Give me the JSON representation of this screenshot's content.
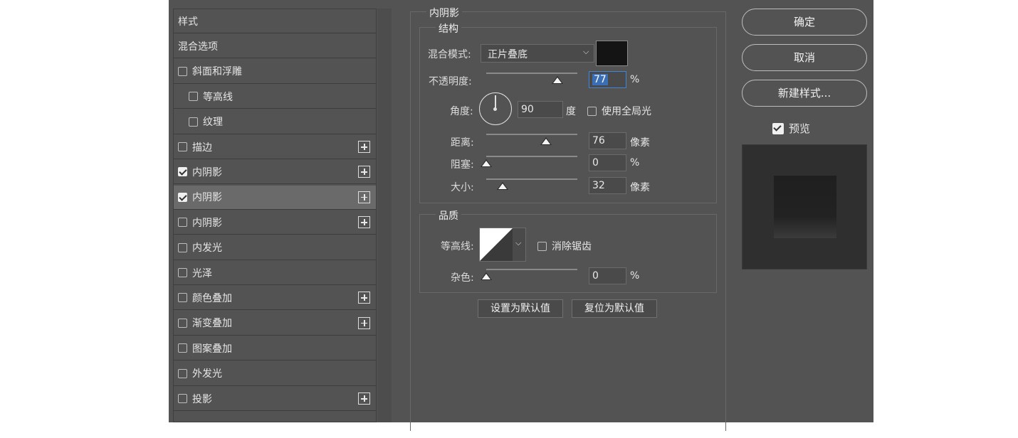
{
  "styles_list": {
    "items": [
      {
        "label": "样式",
        "checkbox": false,
        "checked": false,
        "plus": false,
        "indent": 0,
        "selected": false
      },
      {
        "label": "混合选项",
        "checkbox": false,
        "checked": false,
        "plus": false,
        "indent": 0,
        "selected": false
      },
      {
        "label": "斜面和浮雕",
        "checkbox": true,
        "checked": false,
        "plus": false,
        "indent": 0,
        "selected": false
      },
      {
        "label": "等高线",
        "checkbox": true,
        "checked": false,
        "plus": false,
        "indent": 1,
        "selected": false
      },
      {
        "label": "纹理",
        "checkbox": true,
        "checked": false,
        "plus": false,
        "indent": 1,
        "selected": false
      },
      {
        "label": "描边",
        "checkbox": true,
        "checked": false,
        "plus": true,
        "indent": 0,
        "selected": false
      },
      {
        "label": "内阴影",
        "checkbox": true,
        "checked": true,
        "plus": true,
        "indent": 0,
        "selected": false
      },
      {
        "label": "内阴影",
        "checkbox": true,
        "checked": true,
        "plus": true,
        "indent": 0,
        "selected": true
      },
      {
        "label": "内阴影",
        "checkbox": true,
        "checked": false,
        "plus": true,
        "indent": 0,
        "selected": false
      },
      {
        "label": "内发光",
        "checkbox": true,
        "checked": false,
        "plus": false,
        "indent": 0,
        "selected": false
      },
      {
        "label": "光泽",
        "checkbox": true,
        "checked": false,
        "plus": false,
        "indent": 0,
        "selected": false
      },
      {
        "label": "颜色叠加",
        "checkbox": true,
        "checked": false,
        "plus": true,
        "indent": 0,
        "selected": false
      },
      {
        "label": "渐变叠加",
        "checkbox": true,
        "checked": false,
        "plus": true,
        "indent": 0,
        "selected": false
      },
      {
        "label": "图案叠加",
        "checkbox": true,
        "checked": false,
        "plus": false,
        "indent": 0,
        "selected": false
      },
      {
        "label": "外发光",
        "checkbox": true,
        "checked": false,
        "plus": false,
        "indent": 0,
        "selected": false
      },
      {
        "label": "投影",
        "checkbox": true,
        "checked": false,
        "plus": true,
        "indent": 0,
        "selected": false
      }
    ]
  },
  "panel": {
    "title": "内阴影",
    "structure": {
      "title": "结构",
      "blend_mode_label": "混合模式:",
      "blend_mode_value": "正片叠底",
      "shadow_color": "#141414",
      "opacity_label": "不透明度:",
      "opacity_value": "77",
      "opacity_unit": "%",
      "angle_label": "角度:",
      "angle_value": "90",
      "angle_unit": "度",
      "global_light_label": "使用全局光",
      "global_light_checked": false,
      "distance_label": "距离:",
      "distance_value": "76",
      "distance_unit": "像素",
      "choke_label": "阻塞:",
      "choke_value": "0",
      "choke_unit": "%",
      "size_label": "大小:",
      "size_value": "32",
      "size_unit": "像素"
    },
    "quality": {
      "title": "品质",
      "contour_label": "等高线:",
      "antialias_label": "消除锯齿",
      "antialias_checked": false,
      "noise_label": "杂色:",
      "noise_value": "0",
      "noise_unit": "%"
    },
    "make_default_label": "设置为默认值",
    "reset_default_label": "复位为默认值"
  },
  "buttons": {
    "ok_label": "确定",
    "cancel_label": "取消",
    "new_style_label": "新建样式...",
    "preview_label": "预览",
    "preview_checked": true
  },
  "colors": {
    "dialog_bg": "#535353",
    "selected_row": "#6a6a6a",
    "focus_accent": "#3d86d8"
  }
}
